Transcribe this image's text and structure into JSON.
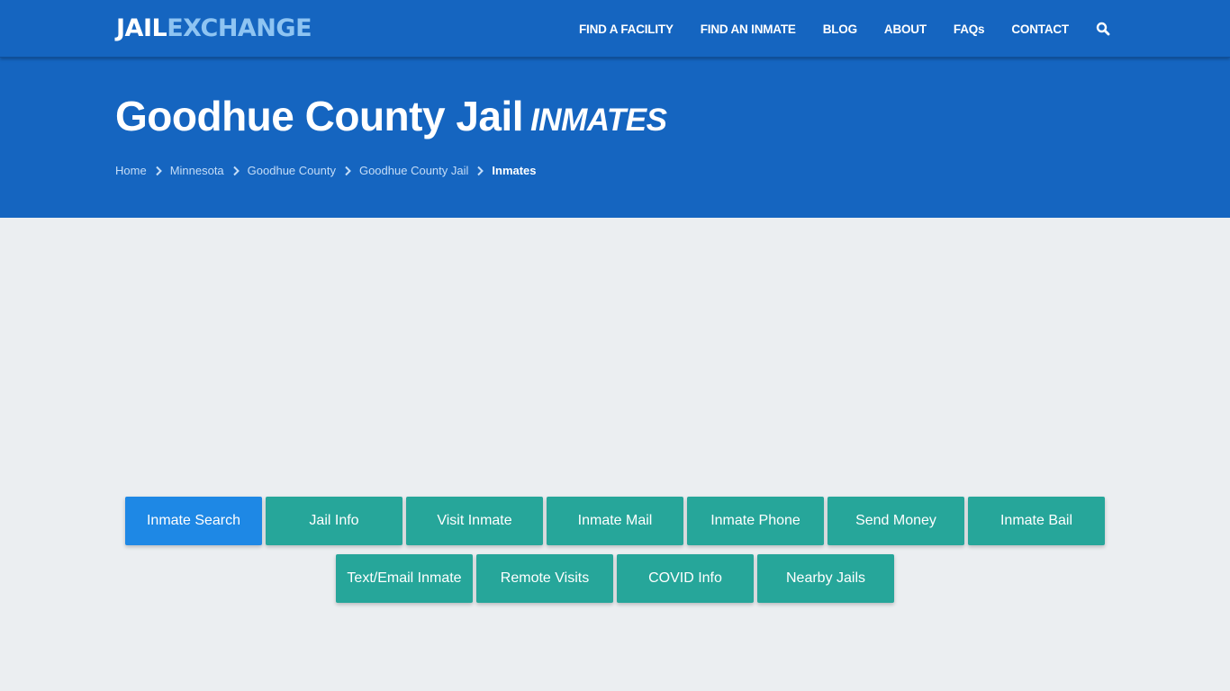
{
  "logo": {
    "part1": "JAIL",
    "part2": "EXCHANGE"
  },
  "nav": {
    "items": [
      "FIND A FACILITY",
      "FIND AN INMATE",
      "BLOG",
      "ABOUT",
      "FAQs",
      "CONTACT"
    ],
    "search_icon": "search-icon"
  },
  "hero": {
    "title": "Goodhue County Jail",
    "subtitle": "INMATES",
    "breadcrumb": [
      "Home",
      "Minnesota",
      "Goodhue County",
      "Goodhue County Jail",
      "Inmates"
    ]
  },
  "buttons": {
    "row1": [
      "Inmate Search",
      "Jail Info",
      "Visit Inmate",
      "Inmate Mail",
      "Inmate Phone",
      "Send Money",
      "Inmate Bail"
    ],
    "row2": [
      "Text/Email Inmate",
      "Remote Visits",
      "COVID Info",
      "Nearby Jails"
    ]
  },
  "colors": {
    "brand_blue": "#1565c0",
    "active_button": "#1e88e5",
    "teal_button": "#26a69a",
    "logo_accent": "#8ec4f2"
  }
}
